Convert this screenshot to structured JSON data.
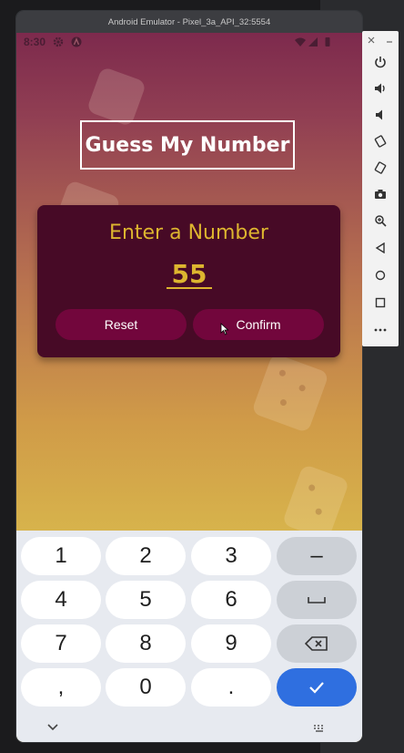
{
  "window": {
    "title": "Android Emulator - Pixel_3a_API_32:5554"
  },
  "statusbar": {
    "time": "8:30"
  },
  "app": {
    "title": "Guess My Number",
    "card_heading": "Enter a Number",
    "number_value": "55",
    "reset_label": "Reset",
    "confirm_label": "Confirm"
  },
  "keyboard": {
    "rows": [
      [
        "1",
        "2",
        "3",
        "–"
      ],
      [
        "4",
        "5",
        "6",
        "space"
      ],
      [
        "7",
        "8",
        "9",
        "backspace"
      ],
      [
        ",",
        "0",
        ".",
        "done"
      ]
    ],
    "labels": {
      "k1": "1",
      "k2": "2",
      "k3": "3",
      "k4": "4",
      "k5": "5",
      "k6": "6",
      "k7": "7",
      "k8": "8",
      "k9": "9",
      "k0": "0",
      "comma": ",",
      "dot": ".",
      "minus": "–"
    }
  },
  "toolbar": {
    "items": [
      "close",
      "minimize",
      "power",
      "volume-up",
      "volume-down",
      "rotate-left",
      "rotate-right",
      "camera",
      "zoom",
      "back",
      "home",
      "overview",
      "more"
    ]
  },
  "colors": {
    "card_bg": "#470a26",
    "accent_gold": "#ddb52f",
    "button_bg": "#72063c",
    "enter_key": "#2f6fe0"
  }
}
